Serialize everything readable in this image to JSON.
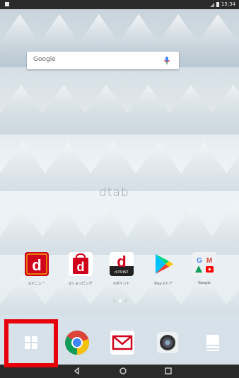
{
  "status_bar": {
    "time": "15:34"
  },
  "search_bar": {
    "logo_text": "Google"
  },
  "wallpaper": {
    "wordmark": "dtab"
  },
  "apps": [
    {
      "label": "dメニュー",
      "icon": "d-menu-icon"
    },
    {
      "label": "dショッピング",
      "icon": "d-shopping-icon"
    },
    {
      "label": "dポイント",
      "icon": "d-point-icon",
      "icon_text": "d POINT"
    },
    {
      "label": "Playストア",
      "icon": "play-store-icon"
    },
    {
      "label": "Google",
      "icon": "google-folder-icon"
    }
  ],
  "page_indicator": {
    "count": 3,
    "active": 1
  },
  "dock": [
    "app-drawer-icon",
    "chrome-icon",
    "mail-icon",
    "camera-icon",
    "book-icon"
  ],
  "colors": {
    "highlight": "#e8000b",
    "docomo_red": "#d0021b"
  }
}
